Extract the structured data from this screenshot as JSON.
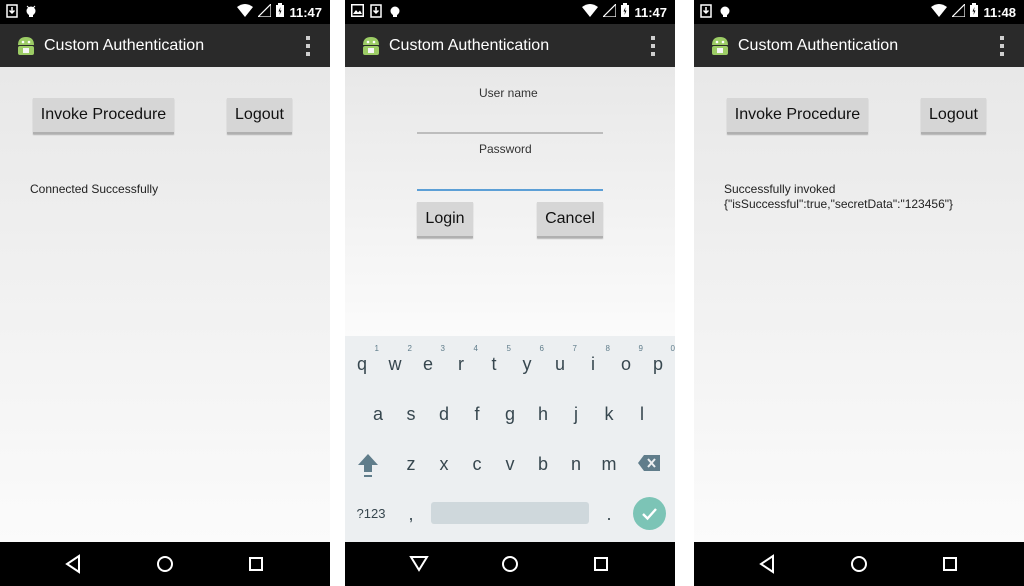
{
  "app": {
    "title": "Custom Authentication"
  },
  "screens": [
    {
      "time": "11:47",
      "invoke_label": "Invoke Procedure",
      "logout_label": "Logout",
      "message": "Connected Successfully"
    },
    {
      "time": "11:47",
      "username_label": "User name",
      "password_label": "Password",
      "login_label": "Login",
      "cancel_label": "Cancel",
      "keyboard": {
        "row1": [
          "q",
          "w",
          "e",
          "r",
          "t",
          "y",
          "u",
          "i",
          "o",
          "p"
        ],
        "row1_digits": [
          "1",
          "2",
          "3",
          "4",
          "5",
          "6",
          "7",
          "8",
          "9",
          "0"
        ],
        "row2": [
          "a",
          "s",
          "d",
          "f",
          "g",
          "h",
          "j",
          "k",
          "l"
        ],
        "row3": [
          "z",
          "x",
          "c",
          "v",
          "b",
          "n",
          "m"
        ],
        "symbols_label": "?123",
        "comma": ",",
        "period": "."
      }
    },
    {
      "time": "11:48",
      "invoke_label": "Invoke Procedure",
      "logout_label": "Logout",
      "message_line1": "Successfully invoked",
      "message_line2": "{\"isSuccessful\":true,\"secretData\":\"123456\"}"
    }
  ],
  "colors": {
    "action_bar": "#2a2a2a",
    "field_active": "#5c9fd6",
    "keyboard_done": "#7cc4b6"
  },
  "icons": [
    "download-icon",
    "android-debug-icon",
    "wifi-icon",
    "signal-icon",
    "battery-icon",
    "back-icon",
    "home-icon",
    "recents-icon",
    "shift-icon",
    "backspace-icon",
    "checkmark-icon",
    "overflow-menu-icon",
    "app-icon"
  ]
}
